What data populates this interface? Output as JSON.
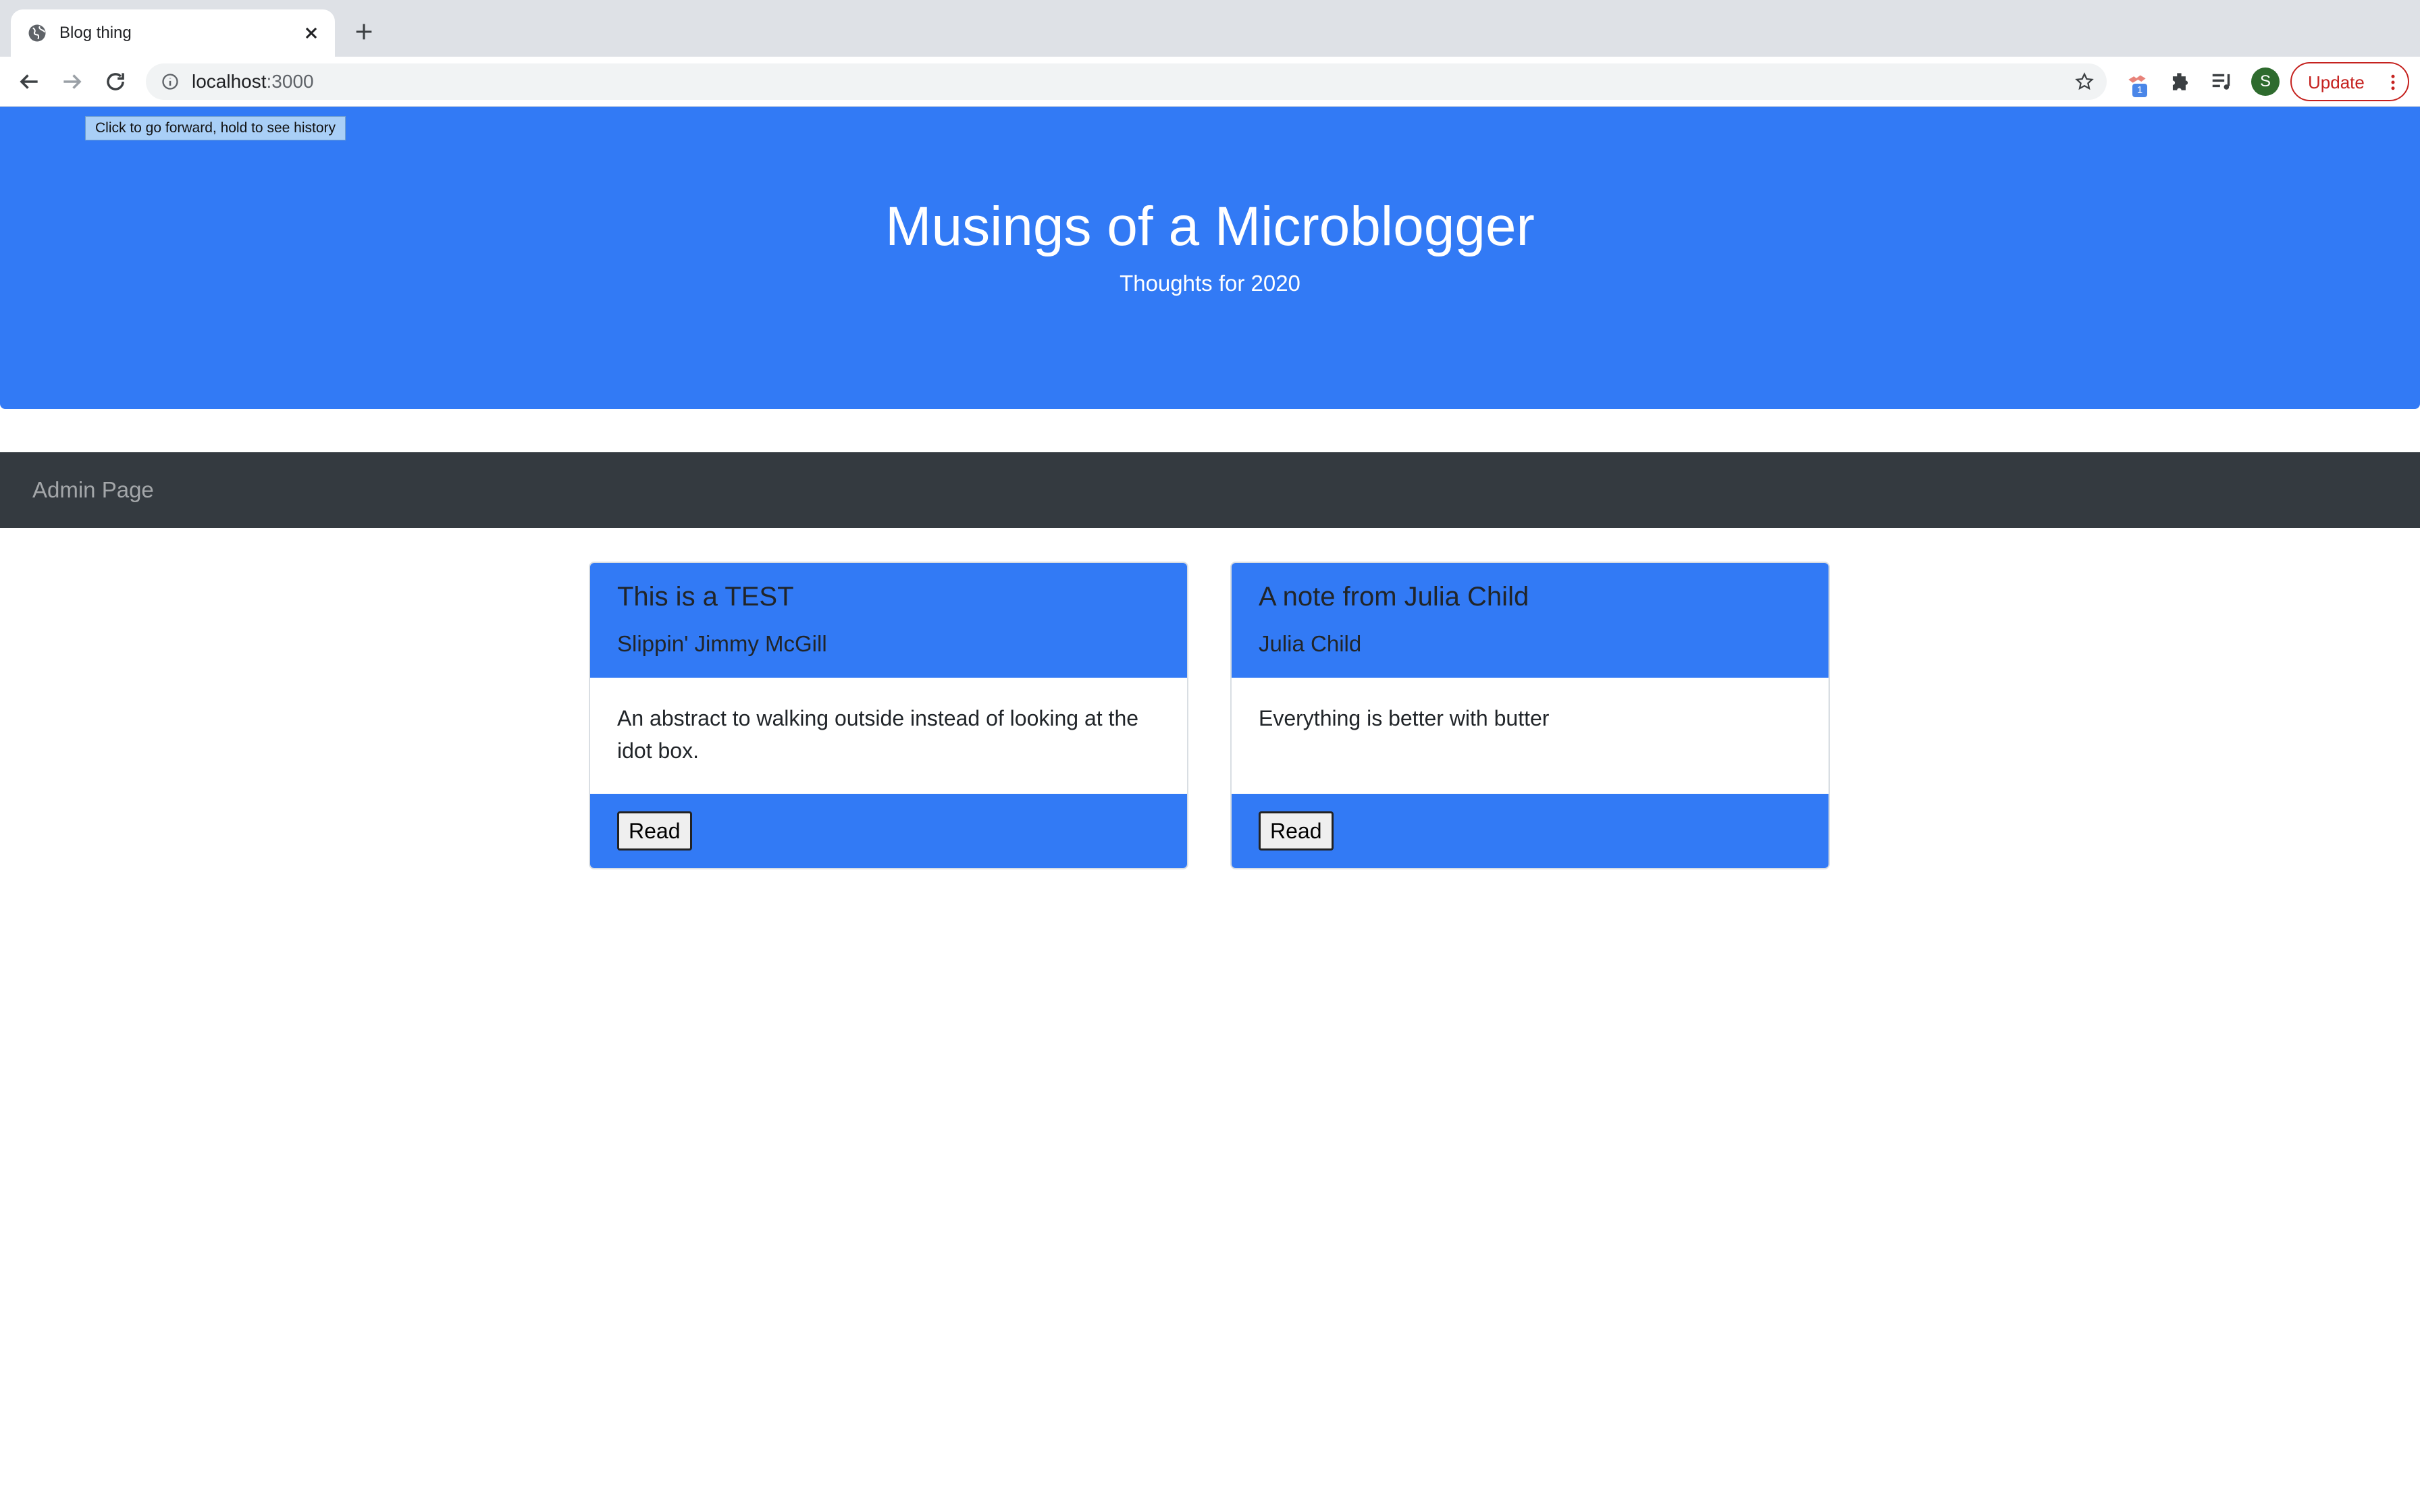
{
  "browser": {
    "tab_title": "Blog thing",
    "url_host": "localhost",
    "url_port": ":3000",
    "update_label": "Update",
    "avatar_letter": "S",
    "extension_badge": "1",
    "tooltip": "Click to go forward, hold to see history"
  },
  "site": {
    "title": "Musings of a Microblogger",
    "subtitle": "Thoughts for 2020"
  },
  "nav": {
    "admin_link": "Admin Page"
  },
  "posts": [
    {
      "title": "This is a TEST",
      "author": "Slippin' Jimmy McGill",
      "abstract": "An abstract to walking outside instead of looking at the idot box.",
      "button": "Read"
    },
    {
      "title": "A note from Julia Child",
      "author": "Julia Child",
      "abstract": "Everything is better with butter",
      "button": "Read"
    }
  ],
  "colors": {
    "primary": "#327af5",
    "navbar": "#343a40",
    "update_red": "#c5221f"
  }
}
